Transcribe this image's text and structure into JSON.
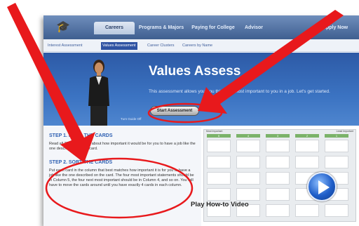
{
  "nav": {
    "tabs": [
      {
        "label": "Careers"
      },
      {
        "label": "Programs & Majors"
      },
      {
        "label": "Paying for College"
      },
      {
        "label": "Advisor"
      },
      {
        "label": "Apply Now"
      }
    ]
  },
  "subnav": {
    "tabs": [
      {
        "label": "Interest Assessment"
      },
      {
        "label": "Values Assessment"
      },
      {
        "label": "Career Clusters"
      },
      {
        "label": "Careers by Name"
      }
    ]
  },
  "hero": {
    "title": "Values Assess",
    "text": "This assessment allows you t                    ou think are most important to you in a job. Let's get started.",
    "start_button": "Start Assessment",
    "tune_out": "Turn Guide Off"
  },
  "steps": {
    "step1_title": "STEP 1. READ THE CARDS",
    "step1_text": "Read all 20 cards. Think about how important it would be for you to have a job like the one described on each card.",
    "step2_title": "STEP 2. SORT THE CARDS",
    "step2_text": "Put each card in the column that best matches how important it is for you to have a job like the one described on the card. The four most important statements should be in Column 5, the four next most important should be in Column 4, and so on. You will have to move the cards around until you have exactly 4 cards in each column."
  },
  "grid": {
    "left_header": "Most Important",
    "right_header": "Least Important",
    "columns": [
      "5",
      "4",
      "3",
      "2",
      "1"
    ],
    "play_label": "Play How-to Video"
  },
  "colors": {
    "accent": "#2f53a3",
    "annotation": "#e8191c"
  }
}
